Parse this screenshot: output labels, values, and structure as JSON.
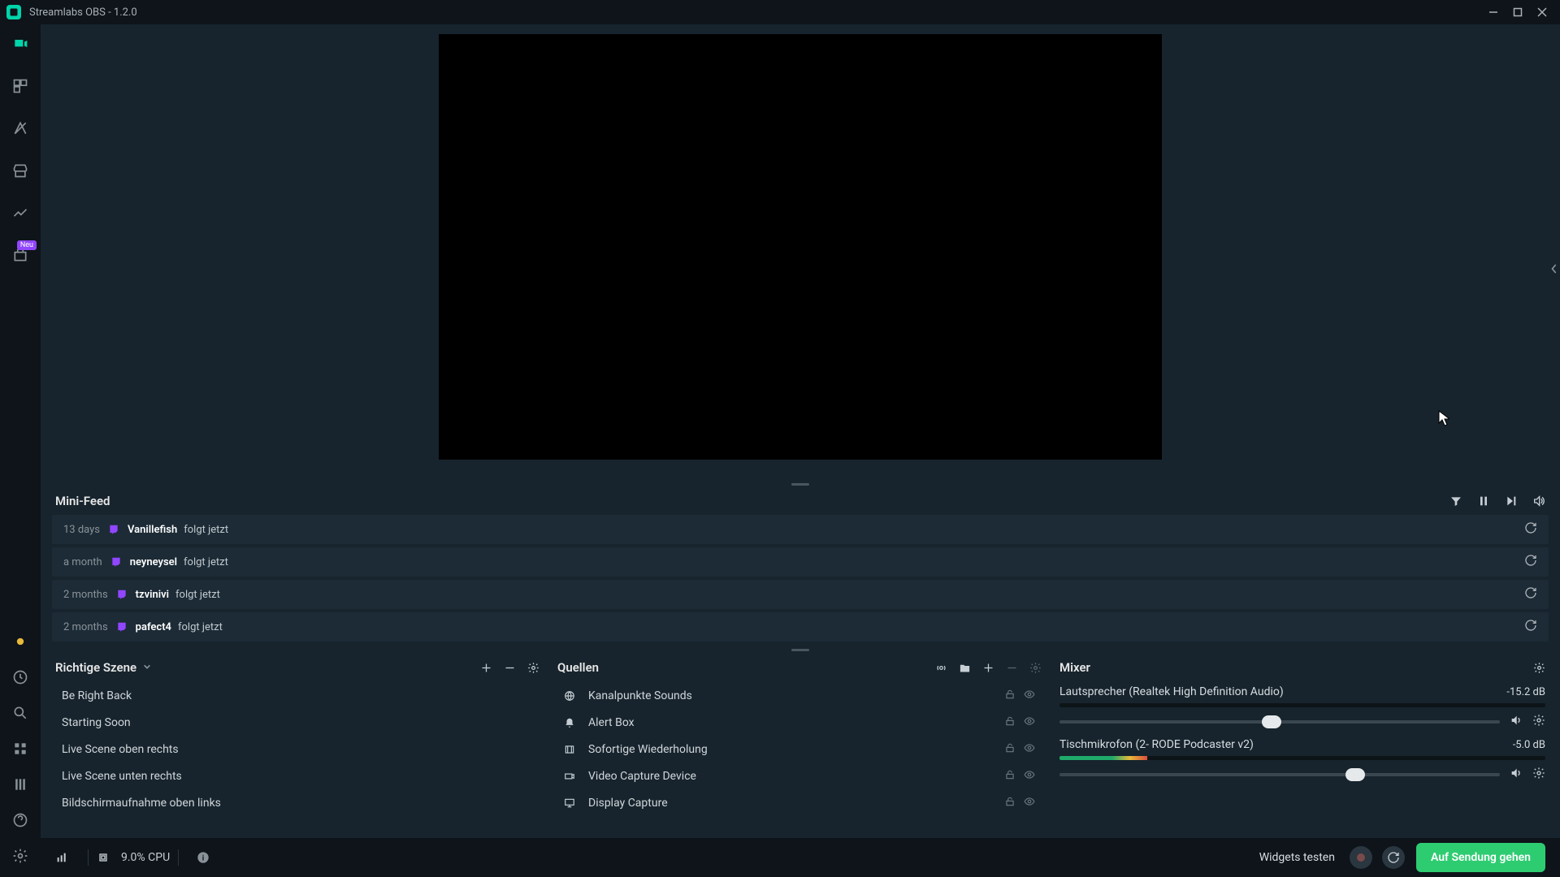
{
  "app": {
    "title": "Streamlabs OBS - 1.2.0"
  },
  "sidenav": {
    "badge": "Neu"
  },
  "minifeed": {
    "title": "Mini-Feed",
    "items": [
      {
        "time": "13 days",
        "user": "Vanillefish",
        "action": "folgt jetzt"
      },
      {
        "time": "a month",
        "user": "neyneysel",
        "action": "folgt jetzt"
      },
      {
        "time": "2 months",
        "user": "tzvinivi",
        "action": "folgt jetzt"
      },
      {
        "time": "2 months",
        "user": "pafect4",
        "action": "folgt jetzt"
      }
    ]
  },
  "scenes": {
    "title": "Richtige Szene",
    "items": [
      {
        "label": "Be Right Back"
      },
      {
        "label": "Starting Soon"
      },
      {
        "label": "Live Scene oben rechts"
      },
      {
        "label": "Live Scene unten rechts"
      },
      {
        "label": "Bildschirmaufnahme oben links"
      }
    ]
  },
  "sources": {
    "title": "Quellen",
    "items": [
      {
        "label": "Kanalpunkte Sounds",
        "icon": "globe"
      },
      {
        "label": "Alert Box",
        "icon": "bell"
      },
      {
        "label": "Sofortige Wiederholung",
        "icon": "clip"
      },
      {
        "label": "Video Capture Device",
        "icon": "camera"
      },
      {
        "label": "Display Capture",
        "icon": "monitor"
      }
    ]
  },
  "mixer": {
    "title": "Mixer",
    "channels": [
      {
        "name": "Lautsprecher (Realtek High Definition Audio)",
        "db": "-15.2 dB",
        "meter_pct": 0,
        "slider_pct": 46
      },
      {
        "name": "Tischmikrofon (2- RODE Podcaster v2)",
        "db": "-5.0 dB",
        "meter_pct": 18,
        "slider_pct": 65
      }
    ]
  },
  "footer": {
    "cpu": "9.0% CPU",
    "widgets": "Widgets testen",
    "go_live": "Auf Sendung gehen"
  }
}
